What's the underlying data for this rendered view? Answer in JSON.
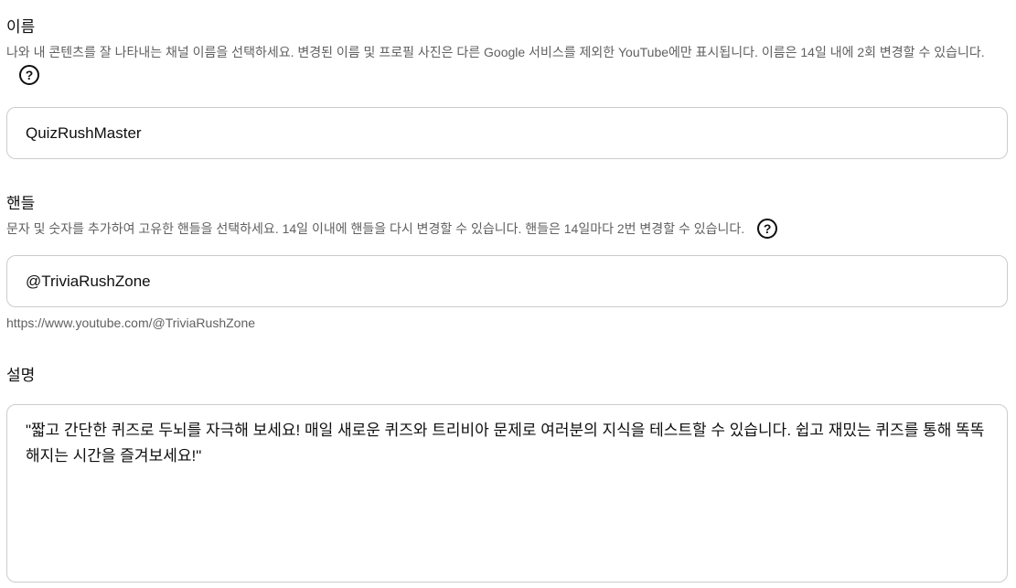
{
  "name_section": {
    "title": "이름",
    "description": "나와 내 콘텐츠를 잘 나타내는 채널 이름을 선택하세요. 변경된 이름 및 프로필 사진은 다른 Google 서비스를 제외한 YouTube에만 표시됩니다. 이름은 14일 내에 2회 변경할 수 있습니다.",
    "help_icon": "help-circle-icon",
    "help_glyph": "?",
    "input_value": "QuizRushMaster"
  },
  "handle_section": {
    "title": "핸들",
    "description": "문자 및 숫자를 추가하여 고유한 핸들을 선택하세요. 14일 이내에 핸들을 다시 변경할 수 있습니다. 핸들은 14일마다 2번 변경할 수 있습니다.",
    "help_icon": "help-circle-icon",
    "help_glyph": "?",
    "input_value": "@TriviaRushZone",
    "url": "https://www.youtube.com/@TriviaRushZone"
  },
  "description_section": {
    "title": "설명",
    "text_value": "\"짧고 간단한 퀴즈로 두뇌를 자극해 보세요! 매일 새로운 퀴즈와 트리비아 문제로 여러분의 지식을 테스트할 수 있습니다. 쉽고 재밌는 퀴즈를 통해 똑똑해지는 시간을 즐겨보세요!\""
  }
}
